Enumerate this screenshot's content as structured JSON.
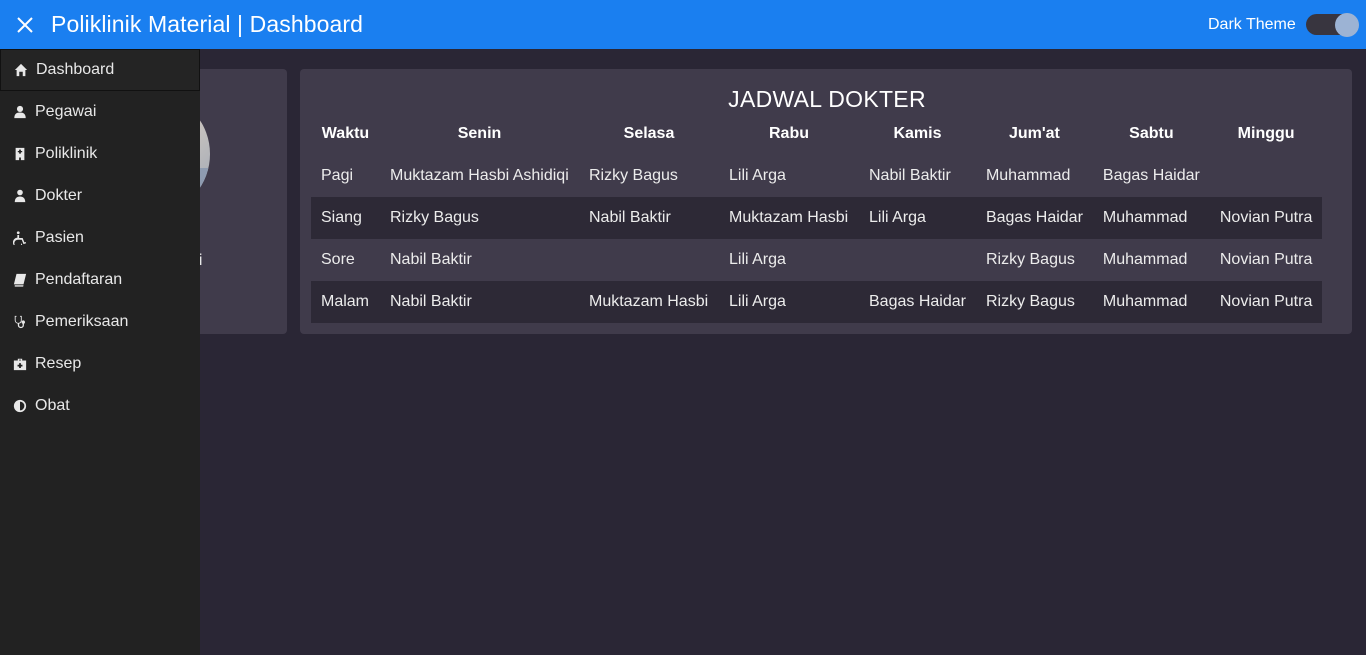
{
  "header": {
    "title": "Poliklinik Material | Dashboard",
    "theme_label": "Dark Theme",
    "theme_enabled": true
  },
  "sidebar": {
    "items": [
      {
        "label": "Dashboard",
        "icon": "home-icon",
        "active": true
      },
      {
        "label": "Pegawai",
        "icon": "user-icon"
      },
      {
        "label": "Poliklinik",
        "icon": "hospital-icon"
      },
      {
        "label": "Dokter",
        "icon": "doctor-icon"
      },
      {
        "label": "Pasien",
        "icon": "wheelchair-icon"
      },
      {
        "label": "Pendaftaran",
        "icon": "book-icon"
      },
      {
        "label": "Pemeriksaan",
        "icon": "stethoscope-icon"
      },
      {
        "label": "Resep",
        "icon": "medkit-icon"
      },
      {
        "label": "Obat",
        "icon": "half-circle-icon"
      }
    ]
  },
  "profile_card": {
    "partial_text": "gi"
  },
  "schedule": {
    "title": "JADWAL DOKTER",
    "columns": [
      "Waktu",
      "Senin",
      "Selasa",
      "Rabu",
      "Kamis",
      "Jum'at",
      "Sabtu",
      "Minggu"
    ],
    "rows": [
      [
        "Pagi",
        "Muktazam Hasbi Ashidiqi",
        "Rizky Bagus",
        "Lili Arga",
        "Nabil Baktir",
        "Muhammad",
        "Bagas Haidar",
        ""
      ],
      [
        "Siang",
        "Rizky Bagus",
        "Nabil Baktir",
        "Muktazam Hasbi",
        "Lili Arga",
        "Bagas Haidar",
        "Muhammad",
        "Novian Putra"
      ],
      [
        "Sore",
        "Nabil Baktir",
        "",
        "Lili Arga",
        "",
        "Rizky Bagus",
        "Muhammad",
        "Novian Putra"
      ],
      [
        "Malam",
        "Nabil Baktir",
        "Muktazam Hasbi",
        "Lili Arga",
        "Bagas Haidar",
        "Rizky Bagus",
        "Muhammad",
        "Novian Putra"
      ]
    ]
  }
}
